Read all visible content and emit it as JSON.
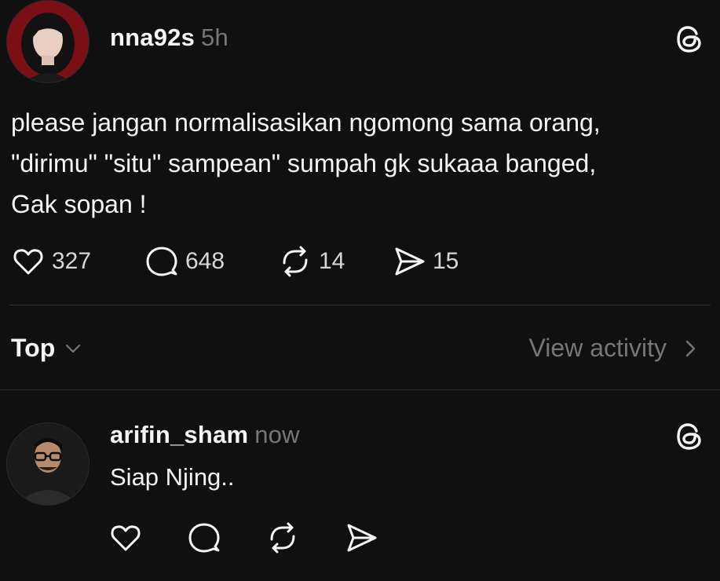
{
  "post": {
    "username": "nna92s",
    "timestamp": "5h",
    "text_lines": [
      "please jangan normalisasikan ngomong sama orang,",
      "\"dirimu\" \"situ\" sampean\" sumpah gk sukaaa banged,",
      "Gak sopan !"
    ],
    "likes": "327",
    "comments": "648",
    "reposts": "14",
    "shares": "15",
    "icons": [
      "threads-icon",
      "heart-icon",
      "comment-icon",
      "repost-icon",
      "share-icon"
    ]
  },
  "sort": {
    "label": "Top",
    "icon": "chevron-down-icon"
  },
  "activity": {
    "label": "View activity",
    "icon": "chevron-right-icon"
  },
  "reply": {
    "username": "arifin_sham",
    "timestamp": "now",
    "text": "Siap Njing.."
  },
  "colors": {
    "background": "#101010",
    "text": "#f3f5f7",
    "muted": "#777777",
    "divider": "#2e2e2e"
  }
}
